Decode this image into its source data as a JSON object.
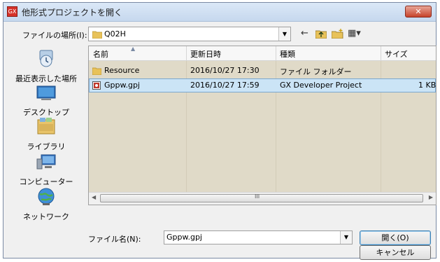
{
  "window": {
    "title": "他形式プロジェクトを開く",
    "app_icon_text": "GX",
    "close_label": "✕"
  },
  "lookin": {
    "label": "ファイルの場所(I):",
    "value": "Q02H"
  },
  "toolbar": {
    "back_icon": "←",
    "up_icon": "⬆",
    "new_folder_icon": "✱",
    "view_icon": "▦▾"
  },
  "places": [
    {
      "label": "最近表示した場所",
      "icon": "recent-places-icon"
    },
    {
      "label": "デスクトップ",
      "icon": "desktop-icon"
    },
    {
      "label": "ライブラリ",
      "icon": "libraries-icon"
    },
    {
      "label": "コンピューター",
      "icon": "computer-icon"
    },
    {
      "label": "ネットワーク",
      "icon": "network-icon"
    }
  ],
  "columns": [
    "名前",
    "更新日時",
    "種類",
    "サイズ"
  ],
  "files": [
    {
      "name": "Resource",
      "date": "2016/10/27 17:30",
      "type": "ファイル フォルダー",
      "size": "",
      "icon": "folder-icon",
      "selected": false
    },
    {
      "name": "Gppw.gpj",
      "date": "2016/10/27 17:59",
      "type": "GX Developer Project",
      "size": "1 KB",
      "icon": "gx-project-file-icon",
      "selected": true
    }
  ],
  "filename": {
    "label": "ファイル名(N):",
    "value": "Gppw.gpj"
  },
  "buttons": {
    "open_label": "開く(O)",
    "cancel_label": "キャンセル"
  },
  "colors": {
    "selection": "#cbe4f6",
    "list_tint": "#e0dac8",
    "titlebar": "#c6d8ee"
  }
}
